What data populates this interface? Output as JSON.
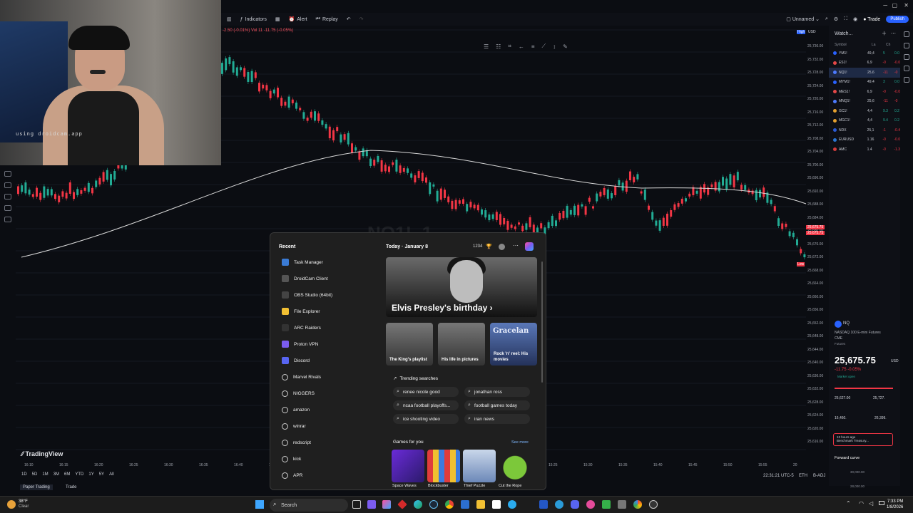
{
  "webcam": {
    "watermark": "using droidcam.app"
  },
  "toolbar": {
    "indicators": "Indicators",
    "alert": "Alert",
    "replay": "Replay",
    "layout_name": "Unnamed",
    "trade": "Trade",
    "publish": "Publish"
  },
  "chart": {
    "ohlc_readout": "-2.50 (-0.01%)  Vol 11  -11.75 (-0.05%)",
    "watermark_symbol": "NQ1!, 1",
    "price_labels": [
      "25,736.00",
      "25,732.00",
      "25,728.00",
      "25,724.00",
      "25,720.00",
      "25,716.00",
      "25,712.00",
      "25,708.00",
      "25,704.00",
      "25,700.00",
      "25,696.00",
      "25,692.00",
      "25,688.00",
      "25,684.00",
      "25,680.00",
      "25,676.00",
      "25,672.00",
      "25,668.00",
      "25,664.00",
      "25,660.00",
      "25,656.00",
      "25,652.00",
      "25,648.00",
      "25,644.00",
      "25,640.00",
      "25,636.00",
      "25,632.00",
      "25,628.00",
      "25,624.00",
      "25,620.00",
      "25,616.00"
    ],
    "time_labels": [
      "16:10",
      "16:15",
      "16:20",
      "16:25",
      "16:30",
      "16:35",
      "16:40",
      "16:45",
      "16:50",
      "16:55",
      "18:00",
      "19:05",
      "15:10",
      "15:15",
      "15:20",
      "15:25",
      "15:30",
      "15:35",
      "15:40",
      "15:45",
      "15:50",
      "15:55",
      "20"
    ],
    "axis_currency": "USD",
    "axis_high": "High",
    "axis_low": "Low",
    "price_tag_high": "25,675.75",
    "price_tag_bid": "25,675.75"
  },
  "bottom": {
    "brand": "TradingView",
    "timeframes": [
      "1D",
      "5D",
      "1M",
      "3M",
      "6M",
      "YTD",
      "1Y",
      "5Y",
      "All"
    ],
    "paper_trading": "Paper Trading",
    "trade_tab": "Trade",
    "timestamp": "22:31:21 UTC-5",
    "session": "ETH",
    "adj": "B-ADJ"
  },
  "watchlist": {
    "title": "Watch...",
    "col_symbol": "Symbol",
    "col_last": "La",
    "col_chg": "Ch",
    "rows": [
      {
        "symbol": "YM1!",
        "last": "49,4",
        "chg": "5",
        "chgp": "0.0",
        "color": "#2962ff",
        "neg": false
      },
      {
        "symbol": "ES1!",
        "last": "6,9",
        "chg": "-0",
        "chgp": "-0.0",
        "color": "#e54848",
        "neg": true
      },
      {
        "symbol": "NQ1!",
        "last": "25,6",
        "chg": "-11",
        "chgp": "-0",
        "color": "#4d7bff",
        "neg": true
      },
      {
        "symbol": "MYM1!",
        "last": "49,4",
        "chg": "3",
        "chgp": "0.0",
        "color": "#2962ff",
        "neg": false
      },
      {
        "symbol": "MES1!",
        "last": "6,9",
        "chg": "-0",
        "chgp": "-0.0",
        "color": "#e54848",
        "neg": true
      },
      {
        "symbol": "MNQ1!",
        "last": "25,6",
        "chg": "-11",
        "chgp": "-0",
        "color": "#4d7bff",
        "neg": true
      },
      {
        "symbol": "GC1!",
        "last": "4,4",
        "chg": "9.3",
        "chgp": "0.2",
        "color": "#e5a02e",
        "neg": false
      },
      {
        "symbol": "MGC1!",
        "last": "4,4",
        "chg": "9.4",
        "chgp": "0.2",
        "color": "#e5a02e",
        "neg": false
      },
      {
        "symbol": "NDX",
        "last": "25,1",
        "chg": "-1",
        "chgp": "-0.4",
        "color": "#2a5bd7",
        "neg": true
      },
      {
        "symbol": "EURUSD",
        "last": "1.16",
        "chg": "-0",
        "chgp": "-0.0",
        "color": "#2a76d2",
        "neg": true
      },
      {
        "symbol": "AMC",
        "last": "1.4",
        "chg": "-0",
        "chgp": "-1.3",
        "color": "#d43c3c",
        "neg": true
      }
    ]
  },
  "detail": {
    "symbol_short": "NQ",
    "name": "NASDAQ 100 E-mini Futures",
    "exchange": "CME",
    "type": "Futures",
    "price": "25,675.75",
    "currency": "USD",
    "change": "-11.75 -0.05%",
    "market": "Market open",
    "day_range_low": "25,627.00",
    "day_range_high": "25,727.",
    "week_low": "16,460.",
    "week_high": "26,399.",
    "news_time": "13 hours ago",
    "news": "Benchmark Treasury...",
    "forward": "Forward curve",
    "fwd_1": "30,000.00",
    "fwd_2": "28,000.00"
  },
  "start_menu": {
    "recent_title": "Recent",
    "recent": [
      {
        "label": "Task Manager",
        "icon": "task-manager-icon",
        "color": "#3a7bd5"
      },
      {
        "label": "DroidCam Client",
        "icon": "droidcam-icon",
        "color": "#555"
      },
      {
        "label": "OBS Studio (64bit)",
        "icon": "obs-icon",
        "color": "#444"
      },
      {
        "label": "File Explorer",
        "icon": "folder-icon",
        "color": "#f2c033"
      },
      {
        "label": "ARC Raiders",
        "icon": "arc-raiders-icon",
        "color": "#333"
      },
      {
        "label": "Proton VPN",
        "icon": "proton-vpn-icon",
        "color": "#7b5cf0"
      },
      {
        "label": "Discord",
        "icon": "discord-icon",
        "color": "#5865f2"
      },
      {
        "label": "Marvel Rivals",
        "icon": "search-icon",
        "color": ""
      },
      {
        "label": "NIGGERS",
        "icon": "search-icon",
        "color": ""
      },
      {
        "label": "amazon",
        "icon": "search-icon",
        "color": ""
      },
      {
        "label": "winrar",
        "icon": "search-icon",
        "color": ""
      },
      {
        "label": "redscript",
        "icon": "search-icon",
        "color": ""
      },
      {
        "label": "kick",
        "icon": "search-icon",
        "color": ""
      },
      {
        "label": "APR",
        "icon": "search-icon",
        "color": ""
      }
    ],
    "today_title": "Today  ·  January 8",
    "counter": "1234",
    "hero_title": "Elvis Presley's birthday ›",
    "thumbs": [
      {
        "label": "The King's playlist"
      },
      {
        "label": "His life in pictures"
      },
      {
        "label": "Rock 'n' reel: His movies",
        "overlay": "Gracelan"
      }
    ],
    "trending_title": "Trending searches",
    "trending": [
      "renee nicole good",
      "jonathan ross",
      "ncaa football playoffs...",
      "football games today",
      "ice shooting video",
      "iran news"
    ],
    "games_title": "Games for you",
    "see_more": "See more",
    "games": [
      "Space Waves",
      "Blockbuster",
      "Thief Puzzle",
      "Cut the Rope"
    ]
  },
  "taskbar": {
    "weather_temp": "38°F",
    "weather_desc": "Clear",
    "search_placeholder": "Search",
    "time": "7:33 PM",
    "date": "1/8/2026"
  }
}
